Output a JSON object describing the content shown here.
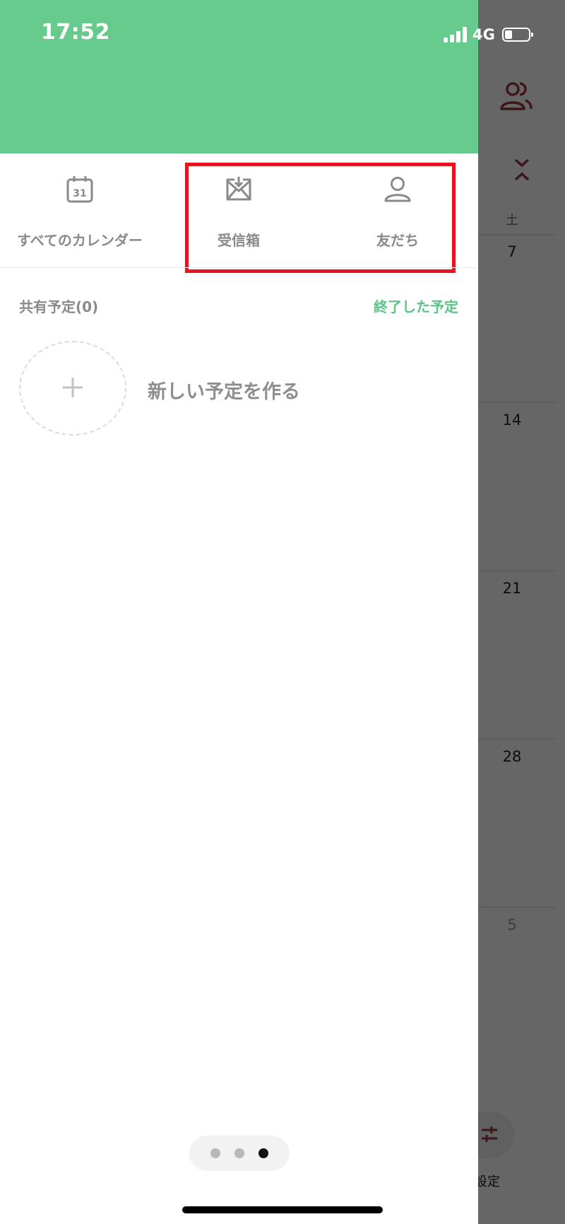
{
  "status_bar": {
    "time": "17:52",
    "network": "4G"
  },
  "drawer": {
    "tabs": [
      {
        "label": "すべてのカレンダー",
        "icon": "calendar-icon",
        "icon_text": "31"
      },
      {
        "label": "受信箱",
        "icon": "inbox-icon"
      },
      {
        "label": "友だち",
        "icon": "person-icon"
      }
    ],
    "shared_section_title": "共有予定(0)",
    "ended_events_link": "終了した予定",
    "new_event_label": "新しい予定を作る",
    "page_indicator": {
      "count": 3,
      "active_index": 2
    }
  },
  "background_calendar": {
    "weekday_label": "土",
    "dates": [
      "7",
      "14",
      "21",
      "28",
      "5"
    ],
    "settings_label": "設定"
  },
  "colors": {
    "header_green": "#66ca8c",
    "link_green": "#5cc487",
    "highlight_red": "#e5141f",
    "accent_red": "#9a3a3a"
  }
}
